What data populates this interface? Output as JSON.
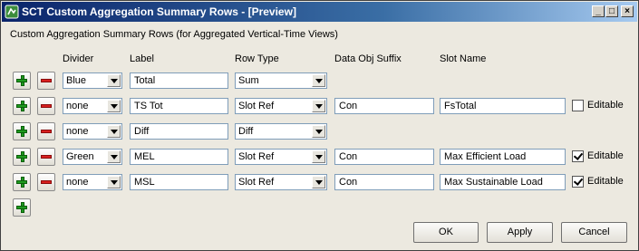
{
  "window": {
    "title": "SCT Custom Aggregation Summary Rows - [Preview]"
  },
  "subtitle": "Custom Aggregation Summary Rows (for Aggregated Vertical-Time Views)",
  "headers": {
    "divider": "Divider",
    "label": "Label",
    "row_type": "Row Type",
    "suffix": "Data Obj Suffix",
    "slot": "Slot Name"
  },
  "rows": [
    {
      "divider": "Blue",
      "label": "Total",
      "row_type": "Sum"
    },
    {
      "divider": "none",
      "label": "TS Tot",
      "row_type": "Slot Ref",
      "suffix": "Con",
      "slot": "FsTotal",
      "editable": false,
      "editable_label": "Editable"
    },
    {
      "divider": "none",
      "label": "Diff",
      "row_type": "Diff"
    },
    {
      "divider": "Green",
      "label": "MEL",
      "row_type": "Slot Ref",
      "suffix": "Con",
      "slot": "Max Efficient Load",
      "editable": true,
      "editable_label": "Editable"
    },
    {
      "divider": "none",
      "label": "MSL",
      "row_type": "Slot Ref",
      "suffix": "Con",
      "slot": "Max Sustainable Load",
      "editable": true,
      "editable_label": "Editable"
    }
  ],
  "buttons": {
    "ok": "OK",
    "apply": "Apply",
    "cancel": "Cancel"
  }
}
